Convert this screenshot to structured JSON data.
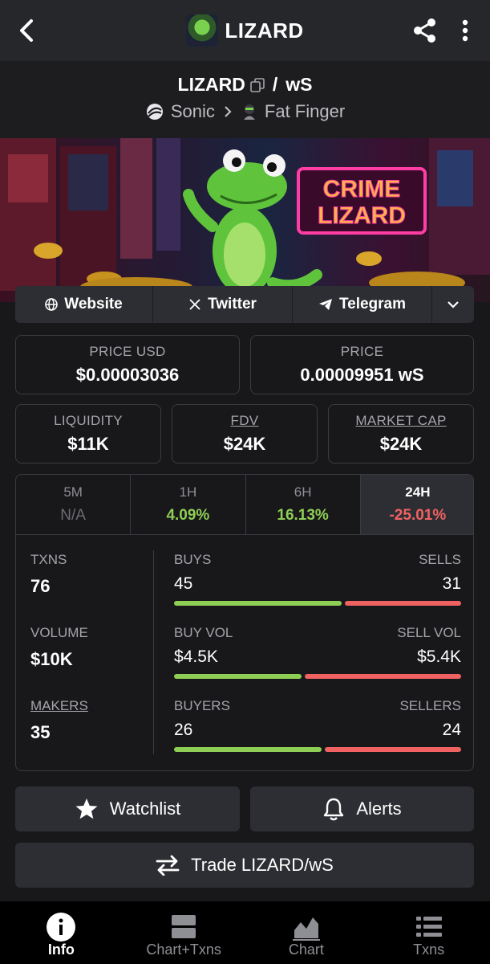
{
  "header": {
    "title": "LIZARD",
    "icons": [
      "back-arrow-icon",
      "share-icon",
      "more-vertical-icon"
    ]
  },
  "pair": {
    "base": "LIZARD",
    "quote": "wS",
    "separator": "/",
    "chain": "Sonic",
    "dex": "Fat Finger"
  },
  "banner": {
    "sign_line1": "CRIME",
    "sign_line2": "LIZARD"
  },
  "socials": {
    "website": "Website",
    "twitter": "Twitter",
    "telegram": "Telegram"
  },
  "prices": {
    "price_usd_label": "PRICE USD",
    "price_usd": "$0.00003036",
    "price_label": "PRICE",
    "price": "0.00009951 wS"
  },
  "metrics": {
    "liquidity_label": "LIQUIDITY",
    "liquidity": "$11K",
    "fdv_label": "FDV",
    "fdv": "$24K",
    "mcap_label": "MARKET CAP",
    "mcap": "$24K"
  },
  "changes": [
    {
      "label": "5M",
      "value": "N/A"
    },
    {
      "label": "1H",
      "value": "4.09%"
    },
    {
      "label": "6H",
      "value": "16.13%"
    },
    {
      "label": "24H",
      "value": "-25.01%"
    }
  ],
  "txn_stats": {
    "txns_label": "TXNS",
    "txns": "76",
    "buys_label": "BUYS",
    "buys": "45",
    "sells_label": "SELLS",
    "sells": "31",
    "volume_label": "VOLUME",
    "volume": "$10K",
    "buy_vol_label": "BUY VOL",
    "buy_vol": "$4.5K",
    "sell_vol_label": "SELL VOL",
    "sell_vol": "$5.4K",
    "makers_label": "MAKERS",
    "makers": "35",
    "buyers_label": "BUYERS",
    "buyers": "26",
    "sellers_label": "SELLERS",
    "sellers": "24",
    "buys_fraction": 0.59,
    "buy_vol_fraction": 0.45,
    "buyers_fraction": 0.52
  },
  "actions": {
    "watchlist": "Watchlist",
    "alerts": "Alerts",
    "trade": "Trade LIZARD/wS"
  },
  "nav": [
    {
      "label": "Info",
      "icon": "info-icon"
    },
    {
      "label": "Chart+Txns",
      "icon": "chart-txns-icon"
    },
    {
      "label": "Chart",
      "icon": "chart-icon"
    },
    {
      "label": "Txns",
      "icon": "list-icon"
    }
  ],
  "colors": {
    "positive": "#8fce55",
    "negative": "#f06262",
    "background": "#18181b"
  }
}
